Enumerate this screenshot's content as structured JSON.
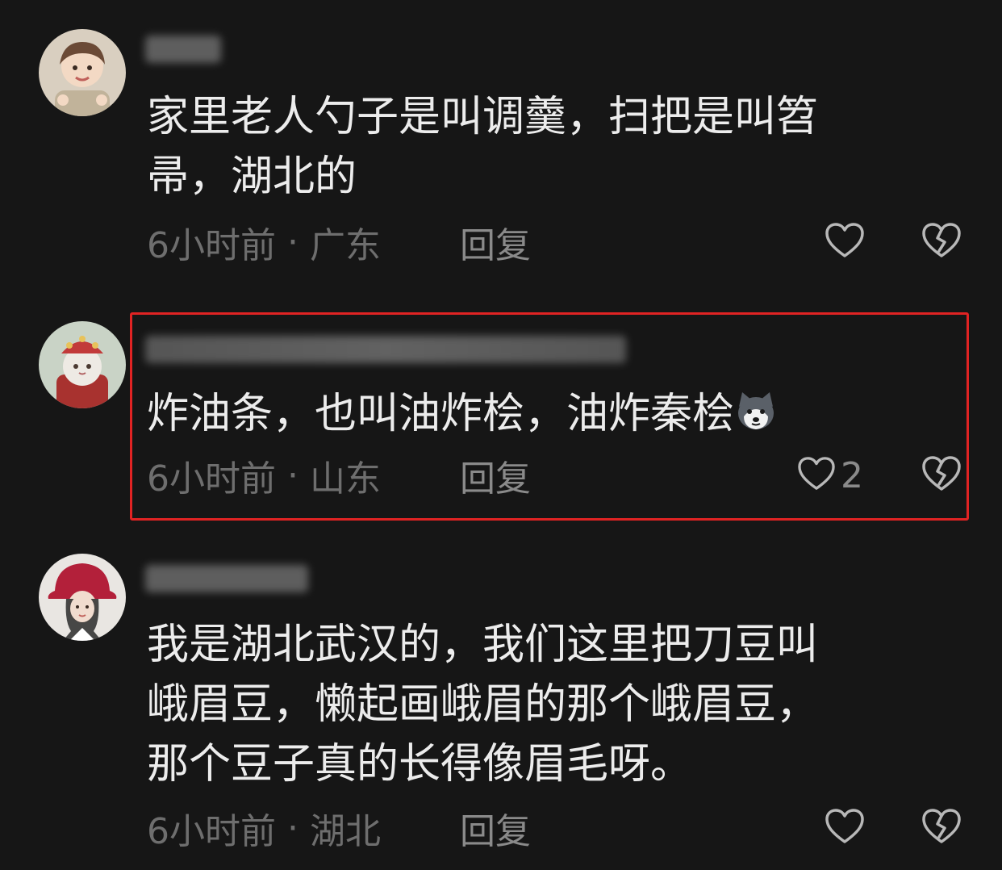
{
  "comments": [
    {
      "content": "家里老人勺子是叫调羹，扫把是叫笤\n帚，湖北的",
      "time": "6小时前",
      "separator": "·",
      "location": "广东",
      "reply_label": "回复",
      "like_count": ""
    },
    {
      "content": "炸油条，也叫油炸桧，油炸秦桧",
      "emoji_icon": "husky-dog-emoji-icon",
      "time": "6小时前",
      "separator": "·",
      "location": "山东",
      "reply_label": "回复",
      "like_count": "2",
      "highlight_color": "#e02323"
    },
    {
      "content": "我是湖北武汉的，我们这里把刀豆叫\n峨眉豆，懒起画峨眉的那个峨眉豆，\n那个豆子真的长得像眉毛呀。",
      "time": "6小时前",
      "separator": "·",
      "location": "湖北",
      "reply_label": "回复",
      "like_count": ""
    }
  ],
  "icons": {
    "like": "heart-outline-icon",
    "dislike": "broken-heart-icon"
  },
  "colors": {
    "background": "#161616",
    "text": "#ececec",
    "meta": "#6e6e6e",
    "highlight": "#e02323"
  }
}
